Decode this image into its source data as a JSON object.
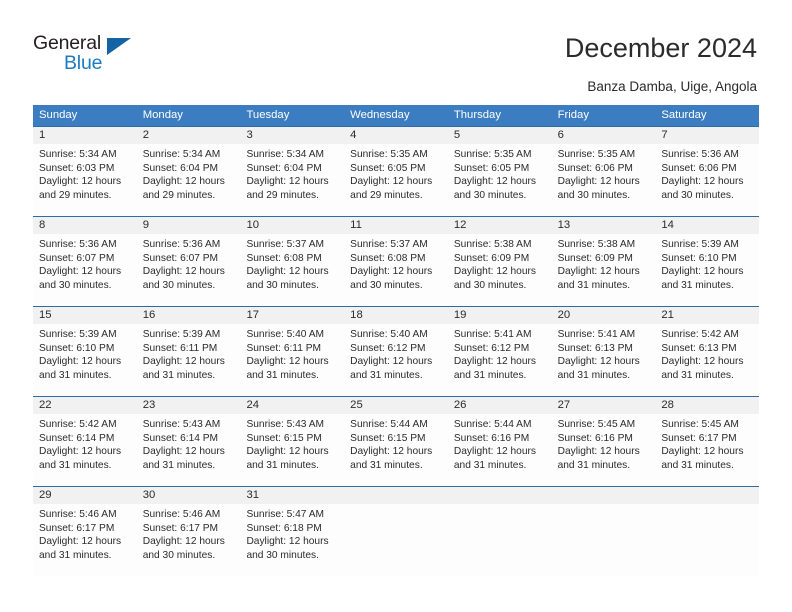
{
  "brand": {
    "logo_top": "General",
    "logo_bottom": "Blue",
    "accent_color": "#1a7bc4"
  },
  "header": {
    "title": "December 2024",
    "location": "Banza Damba, Uige, Angola"
  },
  "calendar": {
    "header_bg": "#3b7dc0",
    "daynum_bg": "#f1f1f1",
    "weekdays": [
      "Sunday",
      "Monday",
      "Tuesday",
      "Wednesday",
      "Thursday",
      "Friday",
      "Saturday"
    ],
    "weeks": [
      [
        {
          "day": "1",
          "sunrise": "Sunrise: 5:34 AM",
          "sunset": "Sunset: 6:03 PM",
          "daylight1": "Daylight: 12 hours",
          "daylight2": "and 29 minutes."
        },
        {
          "day": "2",
          "sunrise": "Sunrise: 5:34 AM",
          "sunset": "Sunset: 6:04 PM",
          "daylight1": "Daylight: 12 hours",
          "daylight2": "and 29 minutes."
        },
        {
          "day": "3",
          "sunrise": "Sunrise: 5:34 AM",
          "sunset": "Sunset: 6:04 PM",
          "daylight1": "Daylight: 12 hours",
          "daylight2": "and 29 minutes."
        },
        {
          "day": "4",
          "sunrise": "Sunrise: 5:35 AM",
          "sunset": "Sunset: 6:05 PM",
          "daylight1": "Daylight: 12 hours",
          "daylight2": "and 29 minutes."
        },
        {
          "day": "5",
          "sunrise": "Sunrise: 5:35 AM",
          "sunset": "Sunset: 6:05 PM",
          "daylight1": "Daylight: 12 hours",
          "daylight2": "and 30 minutes."
        },
        {
          "day": "6",
          "sunrise": "Sunrise: 5:35 AM",
          "sunset": "Sunset: 6:06 PM",
          "daylight1": "Daylight: 12 hours",
          "daylight2": "and 30 minutes."
        },
        {
          "day": "7",
          "sunrise": "Sunrise: 5:36 AM",
          "sunset": "Sunset: 6:06 PM",
          "daylight1": "Daylight: 12 hours",
          "daylight2": "and 30 minutes."
        }
      ],
      [
        {
          "day": "8",
          "sunrise": "Sunrise: 5:36 AM",
          "sunset": "Sunset: 6:07 PM",
          "daylight1": "Daylight: 12 hours",
          "daylight2": "and 30 minutes."
        },
        {
          "day": "9",
          "sunrise": "Sunrise: 5:36 AM",
          "sunset": "Sunset: 6:07 PM",
          "daylight1": "Daylight: 12 hours",
          "daylight2": "and 30 minutes."
        },
        {
          "day": "10",
          "sunrise": "Sunrise: 5:37 AM",
          "sunset": "Sunset: 6:08 PM",
          "daylight1": "Daylight: 12 hours",
          "daylight2": "and 30 minutes."
        },
        {
          "day": "11",
          "sunrise": "Sunrise: 5:37 AM",
          "sunset": "Sunset: 6:08 PM",
          "daylight1": "Daylight: 12 hours",
          "daylight2": "and 30 minutes."
        },
        {
          "day": "12",
          "sunrise": "Sunrise: 5:38 AM",
          "sunset": "Sunset: 6:09 PM",
          "daylight1": "Daylight: 12 hours",
          "daylight2": "and 30 minutes."
        },
        {
          "day": "13",
          "sunrise": "Sunrise: 5:38 AM",
          "sunset": "Sunset: 6:09 PM",
          "daylight1": "Daylight: 12 hours",
          "daylight2": "and 31 minutes."
        },
        {
          "day": "14",
          "sunrise": "Sunrise: 5:39 AM",
          "sunset": "Sunset: 6:10 PM",
          "daylight1": "Daylight: 12 hours",
          "daylight2": "and 31 minutes."
        }
      ],
      [
        {
          "day": "15",
          "sunrise": "Sunrise: 5:39 AM",
          "sunset": "Sunset: 6:10 PM",
          "daylight1": "Daylight: 12 hours",
          "daylight2": "and 31 minutes."
        },
        {
          "day": "16",
          "sunrise": "Sunrise: 5:39 AM",
          "sunset": "Sunset: 6:11 PM",
          "daylight1": "Daylight: 12 hours",
          "daylight2": "and 31 minutes."
        },
        {
          "day": "17",
          "sunrise": "Sunrise: 5:40 AM",
          "sunset": "Sunset: 6:11 PM",
          "daylight1": "Daylight: 12 hours",
          "daylight2": "and 31 minutes."
        },
        {
          "day": "18",
          "sunrise": "Sunrise: 5:40 AM",
          "sunset": "Sunset: 6:12 PM",
          "daylight1": "Daylight: 12 hours",
          "daylight2": "and 31 minutes."
        },
        {
          "day": "19",
          "sunrise": "Sunrise: 5:41 AM",
          "sunset": "Sunset: 6:12 PM",
          "daylight1": "Daylight: 12 hours",
          "daylight2": "and 31 minutes."
        },
        {
          "day": "20",
          "sunrise": "Sunrise: 5:41 AM",
          "sunset": "Sunset: 6:13 PM",
          "daylight1": "Daylight: 12 hours",
          "daylight2": "and 31 minutes."
        },
        {
          "day": "21",
          "sunrise": "Sunrise: 5:42 AM",
          "sunset": "Sunset: 6:13 PM",
          "daylight1": "Daylight: 12 hours",
          "daylight2": "and 31 minutes."
        }
      ],
      [
        {
          "day": "22",
          "sunrise": "Sunrise: 5:42 AM",
          "sunset": "Sunset: 6:14 PM",
          "daylight1": "Daylight: 12 hours",
          "daylight2": "and 31 minutes."
        },
        {
          "day": "23",
          "sunrise": "Sunrise: 5:43 AM",
          "sunset": "Sunset: 6:14 PM",
          "daylight1": "Daylight: 12 hours",
          "daylight2": "and 31 minutes."
        },
        {
          "day": "24",
          "sunrise": "Sunrise: 5:43 AM",
          "sunset": "Sunset: 6:15 PM",
          "daylight1": "Daylight: 12 hours",
          "daylight2": "and 31 minutes."
        },
        {
          "day": "25",
          "sunrise": "Sunrise: 5:44 AM",
          "sunset": "Sunset: 6:15 PM",
          "daylight1": "Daylight: 12 hours",
          "daylight2": "and 31 minutes."
        },
        {
          "day": "26",
          "sunrise": "Sunrise: 5:44 AM",
          "sunset": "Sunset: 6:16 PM",
          "daylight1": "Daylight: 12 hours",
          "daylight2": "and 31 minutes."
        },
        {
          "day": "27",
          "sunrise": "Sunrise: 5:45 AM",
          "sunset": "Sunset: 6:16 PM",
          "daylight1": "Daylight: 12 hours",
          "daylight2": "and 31 minutes."
        },
        {
          "day": "28",
          "sunrise": "Sunrise: 5:45 AM",
          "sunset": "Sunset: 6:17 PM",
          "daylight1": "Daylight: 12 hours",
          "daylight2": "and 31 minutes."
        }
      ],
      [
        {
          "day": "29",
          "sunrise": "Sunrise: 5:46 AM",
          "sunset": "Sunset: 6:17 PM",
          "daylight1": "Daylight: 12 hours",
          "daylight2": "and 31 minutes."
        },
        {
          "day": "30",
          "sunrise": "Sunrise: 5:46 AM",
          "sunset": "Sunset: 6:17 PM",
          "daylight1": "Daylight: 12 hours",
          "daylight2": "and 30 minutes."
        },
        {
          "day": "31",
          "sunrise": "Sunrise: 5:47 AM",
          "sunset": "Sunset: 6:18 PM",
          "daylight1": "Daylight: 12 hours",
          "daylight2": "and 30 minutes."
        },
        {
          "day": "",
          "sunrise": "",
          "sunset": "",
          "daylight1": "",
          "daylight2": ""
        },
        {
          "day": "",
          "sunrise": "",
          "sunset": "",
          "daylight1": "",
          "daylight2": ""
        },
        {
          "day": "",
          "sunrise": "",
          "sunset": "",
          "daylight1": "",
          "daylight2": ""
        },
        {
          "day": "",
          "sunrise": "",
          "sunset": "",
          "daylight1": "",
          "daylight2": ""
        }
      ]
    ]
  }
}
